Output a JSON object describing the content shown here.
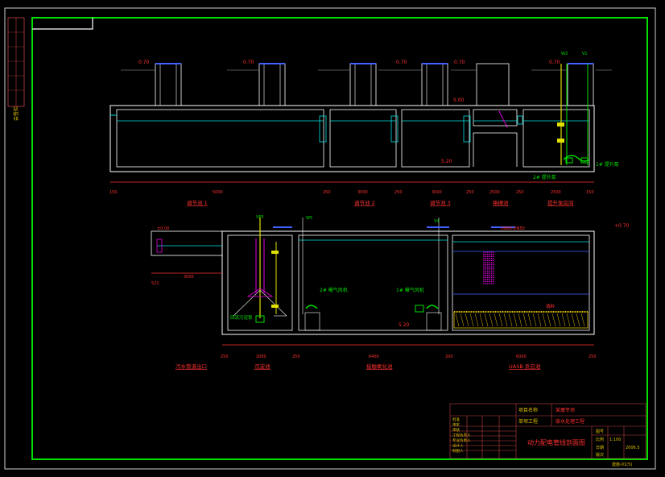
{
  "drawing": {
    "elevations": {
      "top_row": [
        "0.70",
        "0.70",
        "0.70",
        "0.70",
        "0.70"
      ],
      "right_top": "0.70",
      "inner_1": "5.00",
      "inner_2": "5.20",
      "lower_left": "±0.00",
      "lower_right": "+0.70",
      "lower_inner": "5.20"
    },
    "dims_top": [
      "150",
      "5000",
      "250",
      "3000",
      "250",
      "3000",
      "250",
      "2500",
      "250",
      "2500",
      "150"
    ],
    "dims_bottom": [
      "250",
      "2000",
      "250",
      "6400",
      "200",
      "6000",
      "250"
    ],
    "dims_left": [
      "3000",
      "521"
    ],
    "pipes": [
      "W2",
      "V1",
      "W5",
      "V4",
      "W5b",
      "VP5"
    ],
    "top_tank_labels": [
      "调节池 1",
      "调节池 2",
      "调节池 3",
      "格栅池",
      "提升泵房间"
    ],
    "bottom_tank_labels": [
      "污水管道出口",
      "沉淀池",
      "接触氧化池",
      "UASB 反应池"
    ],
    "equipment_labels": [
      "1# 提升泵",
      "2# 提升泵",
      "2# 曝气风机",
      "1# 曝气风机",
      "回流污泥泵",
      "填料"
    ],
    "pipe_top_label": "DN80-DN50",
    "title_block": {
      "project_label": "项目名称",
      "project_value": "某屠宰场",
      "sub_label": "单项工程",
      "sub_value": "废水处理工程",
      "drawing_title": "动力配电管线剖面图",
      "roles": [
        "批准",
        "审定",
        "审核",
        "工程负责人",
        "专业负责人",
        "设计人",
        "制图人"
      ],
      "right_fields": [
        "图号",
        "比例",
        "日期",
        "版次"
      ],
      "right_values": [
        "1:100",
        "2006.5"
      ],
      "footer": "建施-01(5)"
    },
    "margin_stamp": "会签栏"
  }
}
